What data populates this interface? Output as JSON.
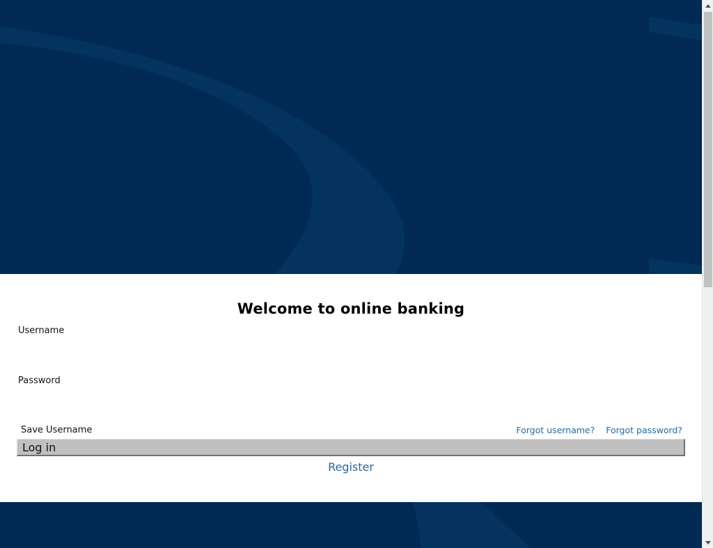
{
  "hero": {
    "background_color": "#002a53",
    "swoosh_color": "#04335f"
  },
  "login": {
    "heading": "Welcome to online banking",
    "username_label": "Username",
    "username_value": "",
    "password_label": "Password",
    "password_value": "",
    "save_username_label": "Save Username",
    "forgot_username": "Forgot username?",
    "forgot_password": "Forgot password?",
    "login_button": "Log in",
    "register_link": "Register"
  },
  "colors": {
    "link": "#1f6aa8",
    "button": "#c0c0c0"
  },
  "scrollbar": {
    "up_icon": "triangle-up-icon",
    "down_icon": "triangle-down-icon"
  }
}
